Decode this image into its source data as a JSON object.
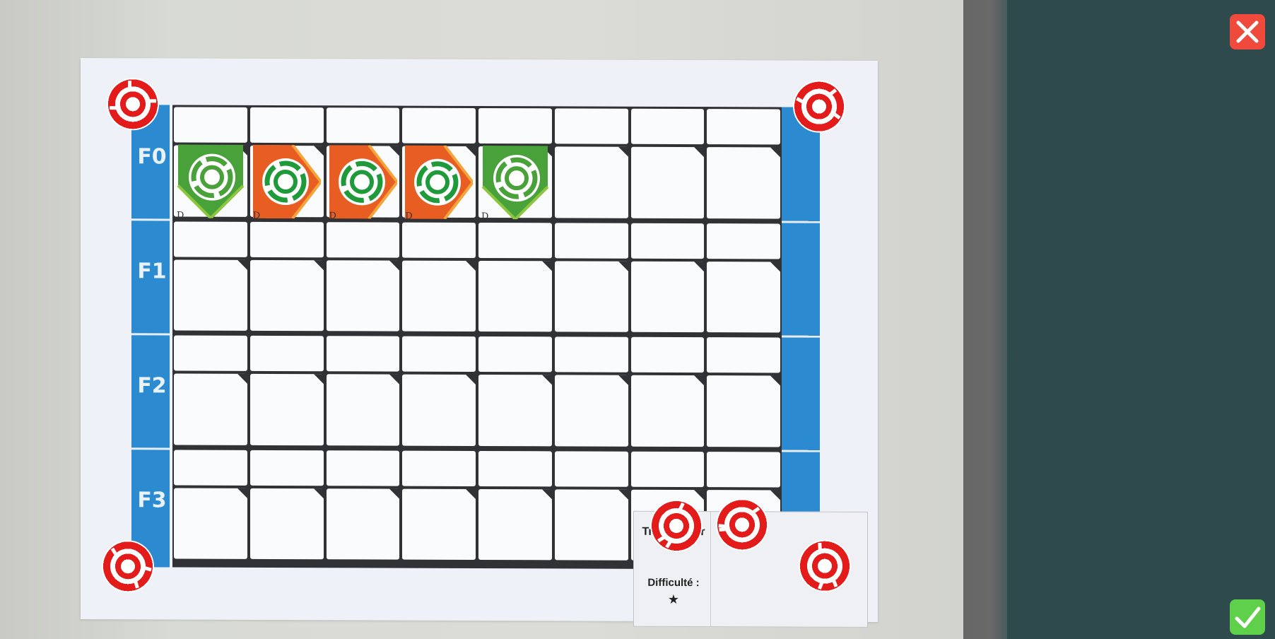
{
  "board": {
    "floors": [
      "F0",
      "F1",
      "F2",
      "F3"
    ],
    "card_title": "Transporter",
    "card_difficulty_label": "Difficulté :",
    "card_difficulty_stars": "★",
    "token_base_letter": "D",
    "tokens": [
      {
        "color": "#49a13a",
        "kind": "green"
      },
      {
        "color": "#e85e22",
        "kind": "orange"
      },
      {
        "color": "#e85e22",
        "kind": "orange"
      },
      {
        "color": "#e85e22",
        "kind": "orange"
      },
      {
        "color": "#49a13a",
        "kind": "green"
      }
    ]
  },
  "colors": {
    "rail": "#2b8ad0",
    "marker": "#e31b1b",
    "token_green": "#49a13a",
    "token_orange": "#e85e22",
    "close": "#ef4a3c",
    "confirm": "#5ed04a",
    "panel": "#2f4a4c"
  },
  "controls": {
    "close_icon": "close-x-icon",
    "confirm_icon": "checkmark-icon"
  }
}
